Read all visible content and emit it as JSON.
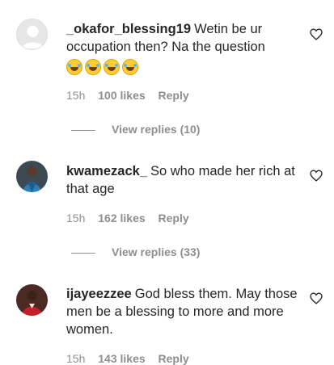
{
  "comments": [
    {
      "username": "_okafor_blessing19",
      "text": "Wetin be ur occupation then? Na the question",
      "emojis": [
        "😂",
        "😂",
        "😂",
        "😂"
      ],
      "time": "15h",
      "likes": "100 likes",
      "reply": "Reply",
      "view_replies": "View replies (10)"
    },
    {
      "username": "kwamezack_",
      "text": "So who made her rich at that age",
      "time": "15h",
      "likes": "162 likes",
      "reply": "Reply",
      "view_replies": "View replies (33)"
    },
    {
      "username": "ijayeezzee",
      "text": "God bless them. May those men be a blessing to more and more women.",
      "time": "15h",
      "likes": "143 likes",
      "reply": "Reply"
    }
  ],
  "colors": {
    "muted": "#8e8e8e",
    "text": "#262626"
  }
}
